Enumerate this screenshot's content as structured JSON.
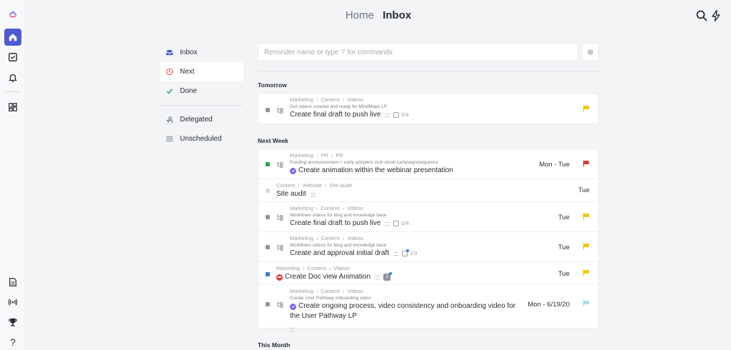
{
  "header": {
    "home": "Home",
    "inbox": "Inbox"
  },
  "rail": {
    "icons": [
      "clickup-logo",
      "home-icon",
      "check-square-icon",
      "bell-icon",
      "dashboard-icon",
      "doc-icon",
      "broadcast-icon",
      "trophy-icon",
      "help-icon"
    ]
  },
  "menu": {
    "inbox": "Inbox",
    "next": "Next",
    "done": "Done",
    "delegated": "Delegated",
    "unscheduled": "Unscheduled"
  },
  "search": {
    "placeholder": "Reminder name or type '/' for commands"
  },
  "colors": {
    "accent": "#4c5bd4",
    "flag_yellow": "#f7c600",
    "flag_red": "#e53935",
    "flag_light": "#a5d8f3",
    "status_green": "#2ea44f",
    "status_blue": "#3a7bd5",
    "status_gray": "#8f959e"
  },
  "sections": {
    "tomorrow": {
      "title": "Tomorrow",
      "tasks": [
        {
          "path": [
            "Marketing",
            "Content",
            "Videos"
          ],
          "desc": "Get videos created and ready for MindMaps LP",
          "title": "Create final draft to push live",
          "checklist": "0/4",
          "due": "",
          "flag": "yellow"
        }
      ]
    },
    "next_week": {
      "title": "Next Week",
      "tasks": [
        {
          "path": [
            "Marketing",
            "PR",
            "PR"
          ],
          "desc": "Funding announcement + early adopters club email campaign/sequence",
          "title": "Create animation within the webinar presentation",
          "due": "Mon - Tue",
          "flag": "red"
        },
        {
          "path": [
            "Content",
            "Website",
            "Site Audit"
          ],
          "desc": "",
          "title": "Site audit",
          "due": "Tue",
          "flag": "none"
        },
        {
          "path": [
            "Marketing",
            "Content",
            "Videos"
          ],
          "desc": "Workflows videos for blog and knowledge base",
          "title": "Create final draft to push live",
          "checklist": "0/4",
          "due": "Tue",
          "flag": "yellow"
        },
        {
          "path": [
            "Marketing",
            "Content",
            "Videos"
          ],
          "desc": "Workflows videos for blog and knowledge base",
          "title": "Create and approval initial draft",
          "checklist": "1/3",
          "due": "Tue",
          "flag": "yellow"
        },
        {
          "path": [
            "Marketing",
            "Content",
            "Videos"
          ],
          "desc": "",
          "title": "Create Doc view Animation",
          "attachment": "1",
          "due": "Tue",
          "flag": "yellow"
        },
        {
          "path": [
            "Marketing",
            "Content",
            "Videos"
          ],
          "desc": "Create User Pathway onboarding video",
          "title_line1": "Create ongoing process, video consistency and onboarding video for",
          "title_line2": "the User Pathway LP",
          "due": "Mon - 6/19/20",
          "flag": "light"
        }
      ]
    },
    "this_month": {
      "title": "This Month"
    }
  }
}
